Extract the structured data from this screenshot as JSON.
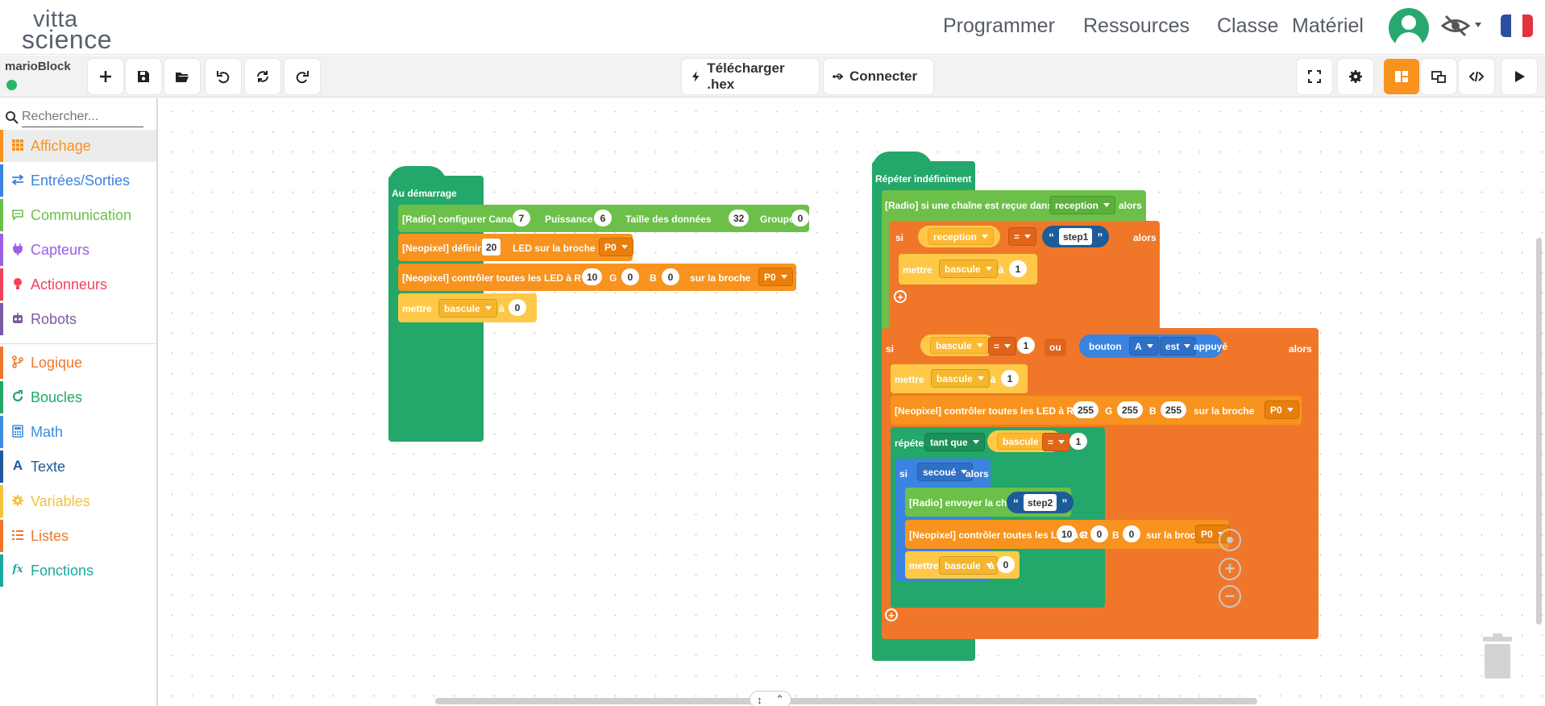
{
  "app": {
    "logo": {
      "line1": "vitta",
      "line2": "science"
    },
    "nav": [
      "Programmer",
      "Ressources",
      "Classe",
      "Matériel"
    ]
  },
  "toolbar": {
    "project_name": "marioBlock",
    "download_label": "Télécharger .hex",
    "connect_label": "Connecter"
  },
  "sidebar": {
    "search_placeholder": "Rechercher...",
    "categories": [
      {
        "label": "Affichage",
        "color": "#f7931e",
        "icon": "grid-icon"
      },
      {
        "label": "Entrées/Sorties",
        "color": "#3a83e0",
        "icon": "arrows-icon"
      },
      {
        "label": "Communication",
        "color": "#6cc04a",
        "icon": "chat-icon"
      },
      {
        "label": "Capteurs",
        "color": "#9c5ee6",
        "icon": "plug-icon"
      },
      {
        "label": "Actionneurs",
        "color": "#f0435a",
        "icon": "bulb-icon"
      },
      {
        "label": "Robots",
        "color": "#7b5aa0",
        "icon": "robot-icon"
      },
      {
        "label": "Logique",
        "color": "#f0772a",
        "icon": "branch-icon"
      },
      {
        "label": "Boucles",
        "color": "#23a76a",
        "icon": "loop-icon"
      },
      {
        "label": "Math",
        "color": "#3d8ddb",
        "icon": "calculator-icon"
      },
      {
        "label": "Texte",
        "color": "#1d5b99",
        "icon": "letter-icon"
      },
      {
        "label": "Variables",
        "color": "#f4c33a",
        "icon": "gear-icon"
      },
      {
        "label": "Listes",
        "color": "#f0772a",
        "icon": "list-icon"
      },
      {
        "label": "Fonctions",
        "color": "#1aa89e",
        "icon": "function-icon"
      }
    ]
  },
  "blocks": {
    "start": {
      "hat": "Au démarrage",
      "radio": {
        "prefix": "[Radio] configurer Canal",
        "canal": "7",
        "puissance_label": "Puissance",
        "puissance": "6",
        "taille_label": "Taille des données",
        "taille": "32",
        "groupe_label": "Groupe",
        "groupe": "0"
      },
      "neo_def": {
        "prefix": "[Neopixel] définir",
        "count": "20",
        "mid": "LED sur la broche",
        "pin": "P0"
      },
      "neo_ctrl": {
        "prefix": "[Neopixel] contrôler toutes les LED à R",
        "r": "10",
        "g_label": "G",
        "g": "0",
        "b_label": "B",
        "b": "0",
        "suffix": "sur la broche",
        "pin": "P0"
      },
      "set": {
        "label": "mettre",
        "var": "bascule",
        "a": "à",
        "value": "0"
      }
    },
    "forever": {
      "hat": "Répéter indéfiniment",
      "radio_if": {
        "prefix": "[Radio] si une chaîne est reçue dans",
        "var": "reception",
        "then": "alors"
      },
      "if1": {
        "si": "si",
        "var": "reception",
        "op": "=",
        "str": "step1",
        "then": "alors"
      },
      "set1": {
        "label": "mettre",
        "var": "bascule",
        "a": "à",
        "value": "1"
      },
      "if2": {
        "si": "si",
        "var": "bascule",
        "op": "=",
        "value": "1",
        "ou": "ou",
        "bouton": "bouton",
        "btn": "A",
        "est": "est",
        "state": "appuyé",
        "then": "alors"
      },
      "set2": {
        "label": "mettre",
        "var": "bascule",
        "a": "à",
        "value": "1"
      },
      "neo2": {
        "prefix": "[Neopixel] contrôler toutes les LED à R",
        "r": "255",
        "g_label": "G",
        "g": "255",
        "b_label": "B",
        "b": "255",
        "suffix": "sur la broche",
        "pin": "P0"
      },
      "repeat": {
        "label": "répéter",
        "mode": "tant que",
        "var": "bascule",
        "op": "=",
        "value": "1"
      },
      "if3": {
        "si": "si",
        "cond": "secoué",
        "then": "alors"
      },
      "send": {
        "prefix": "[Radio] envoyer la chaîne",
        "str": "step2"
      },
      "neo3": {
        "prefix": "[Neopixel] contrôler toutes les LED à R",
        "r": "10",
        "g_label": "G",
        "g": "0",
        "b_label": "B",
        "b": "0",
        "suffix": "sur la broche",
        "pin": "P0"
      },
      "set3": {
        "label": "mettre",
        "var": "bascule",
        "a": "à",
        "value": "0"
      }
    }
  },
  "colors": {
    "loops": "#23a76a",
    "communication": "#6cc04a",
    "display": "#f7931e",
    "logic": "#f0772a",
    "variables": "#ffc947",
    "text": "#1d5b99",
    "inputs": "#3a83e0"
  }
}
